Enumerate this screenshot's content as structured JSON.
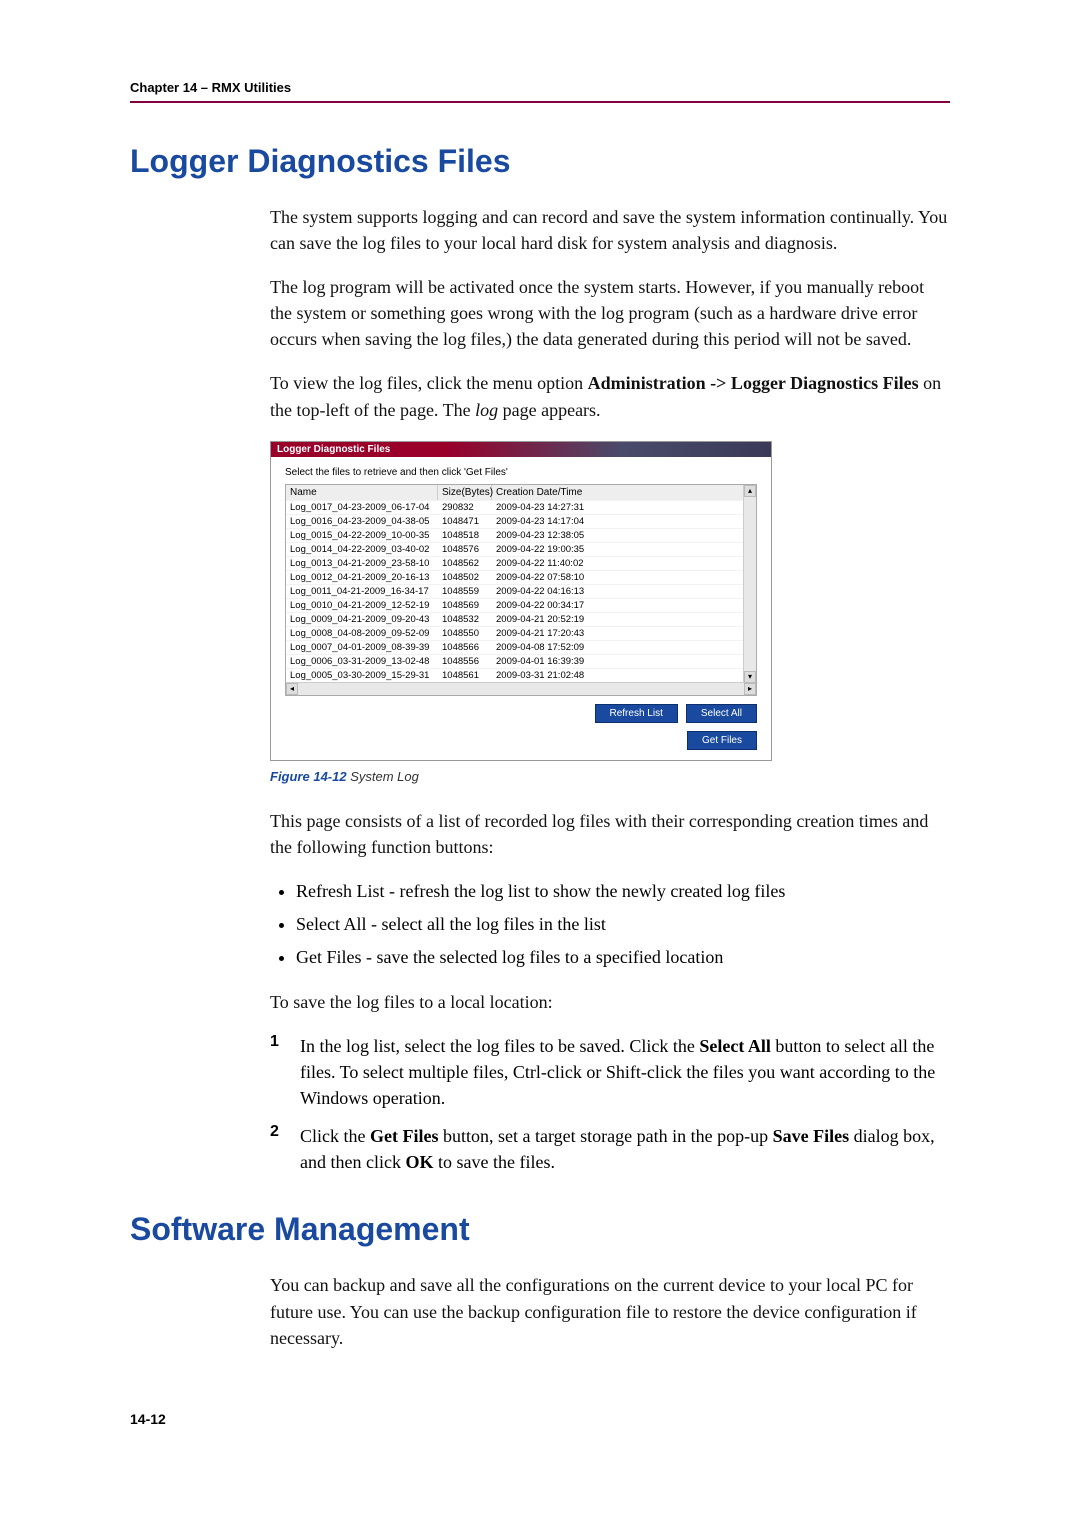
{
  "header": {
    "chapter": "Chapter 14 – RMX Utilities"
  },
  "section1": {
    "title": "Logger Diagnostics Files",
    "para1": "The system supports logging and can record and save the system information continually. You can save the log files to your local hard disk for system analysis and diagnosis.",
    "para2": "The log program will be activated once the system starts. However, if you manually reboot the system or something goes wrong with the log program (such as a hardware drive error occurs when saving the log files,) the data generated during this period will not be saved.",
    "para3_a": "To view the log files, click the menu option ",
    "para3_b": "Administration -> Logger Diagnostics Files",
    "para3_c": " on the top-left of the page. The ",
    "para3_d": "log",
    "para3_e": " page appears."
  },
  "screenshot": {
    "title": "Logger Diagnostic Files",
    "instruction": "Select the files to retrieve and then click 'Get Files'",
    "columns": {
      "name": "Name",
      "size": "Size(Bytes)",
      "date": "Creation Date/Time"
    },
    "rows": [
      {
        "name": "Log_0017_04-23-2009_06-17-04",
        "size": "290832",
        "date": "2009-04-23 14:27:31"
      },
      {
        "name": "Log_0016_04-23-2009_04-38-05",
        "size": "1048471",
        "date": "2009-04-23 14:17:04"
      },
      {
        "name": "Log_0015_04-22-2009_10-00-35",
        "size": "1048518",
        "date": "2009-04-23 12:38:05"
      },
      {
        "name": "Log_0014_04-22-2009_03-40-02",
        "size": "1048576",
        "date": "2009-04-22 19:00:35"
      },
      {
        "name": "Log_0013_04-21-2009_23-58-10",
        "size": "1048562",
        "date": "2009-04-22 11:40:02"
      },
      {
        "name": "Log_0012_04-21-2009_20-16-13",
        "size": "1048502",
        "date": "2009-04-22 07:58:10"
      },
      {
        "name": "Log_0011_04-21-2009_16-34-17",
        "size": "1048559",
        "date": "2009-04-22 04:16:13"
      },
      {
        "name": "Log_0010_04-21-2009_12-52-19",
        "size": "1048569",
        "date": "2009-04-22 00:34:17"
      },
      {
        "name": "Log_0009_04-21-2009_09-20-43",
        "size": "1048532",
        "date": "2009-04-21 20:52:19"
      },
      {
        "name": "Log_0008_04-08-2009_09-52-09",
        "size": "1048550",
        "date": "2009-04-21 17:20:43"
      },
      {
        "name": "Log_0007_04-01-2009_08-39-39",
        "size": "1048566",
        "date": "2009-04-08 17:52:09"
      },
      {
        "name": "Log_0006_03-31-2009_13-02-48",
        "size": "1048556",
        "date": "2009-04-01 16:39:39"
      },
      {
        "name": "Log_0005_03-30-2009_15-29-31",
        "size": "1048561",
        "date": "2009-03-31 21:02:48"
      }
    ],
    "buttons": {
      "refresh": "Refresh List",
      "selectall": "Select All",
      "getfiles": "Get Files"
    }
  },
  "figure": {
    "num": "Figure 14-12",
    "title": " System Log"
  },
  "after_fig": {
    "para": "This page consists of a list of recorded log files with their corresponding creation times and the following function buttons:",
    "bullets": [
      "Refresh List - refresh the log list to show the newly created log files",
      "Select All - select all the log files in the list",
      "Get Files - save the selected log files to a specified location"
    ],
    "para2": "To save the log files to a local location:",
    "step1_a": "In the log list, select the log files to be saved. Click the ",
    "step1_b": "Select All",
    "step1_c": " button to select all the files. To select multiple files, Ctrl-click or Shift-click the files you want according to the Windows operation.",
    "step2_a": "Click the ",
    "step2_b": "Get Files",
    "step2_c": " button, set a target storage path in the pop-up ",
    "step2_d": "Save Files",
    "step2_e": " dialog box, and then click ",
    "step2_f": "OK",
    "step2_g": " to save the files."
  },
  "section2": {
    "title": "Software Management",
    "para": "You can backup and save all the configurations on the current device to your local PC for future use. You can use the backup configuration file to restore the device configuration if necessary."
  },
  "pagenum": "14-12"
}
